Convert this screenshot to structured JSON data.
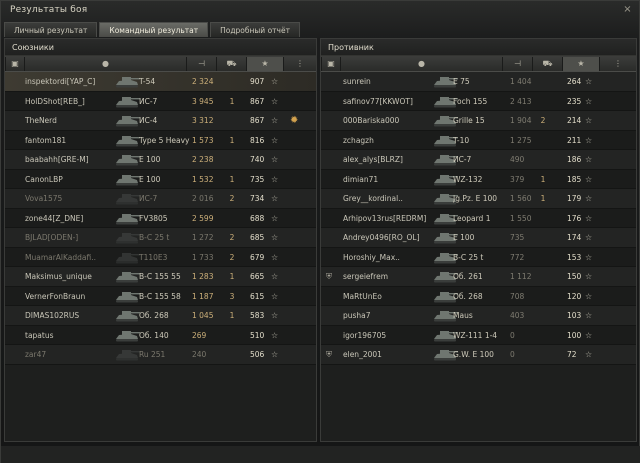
{
  "window": {
    "title": "Результаты боя",
    "close_icon": "×"
  },
  "tabs": [
    {
      "label": "Личный результат",
      "active": false
    },
    {
      "label": "Командный результат",
      "active": true
    },
    {
      "label": "Подробный отчёт",
      "active": false
    }
  ],
  "header_icons": [
    "platoon-icon",
    "player-icon",
    "damage-icon",
    "kills-icon",
    "xp-icon",
    "medals-icon"
  ],
  "allies": {
    "title": "Союзники",
    "rows": [
      {
        "player": "inspektordi[YAP_C]",
        "tank": "T-54",
        "damage": "2 324",
        "kills": "",
        "xp": "907",
        "me": true
      },
      {
        "player": "HolDShot[REB_]",
        "tank": "ИС-7",
        "damage": "3 945",
        "kills": "1",
        "xp": "867"
      },
      {
        "player": "TheNerd",
        "tank": "ИС-4",
        "damage": "3 312",
        "kills": "",
        "xp": "867",
        "medal": true
      },
      {
        "player": "fantom181",
        "tank": "Type 5 Heavy",
        "damage": "1 573",
        "kills": "1",
        "xp": "816"
      },
      {
        "player": "baabahh[GRE-M]",
        "tank": "E 100",
        "damage": "2 238",
        "kills": "",
        "xp": "740"
      },
      {
        "player": "CanonLBP",
        "tank": "E 100",
        "damage": "1 532",
        "kills": "1",
        "xp": "735"
      },
      {
        "player": "Vova1575",
        "tank": "ИС-7",
        "damage": "2 016",
        "kills": "2",
        "xp": "734",
        "dead": true
      },
      {
        "player": "zone44[Z_DNE]",
        "tank": "FV3805",
        "damage": "2 599",
        "kills": "",
        "xp": "688"
      },
      {
        "player": "BJLAD[ODEN-]",
        "tank": "B-C 25 t",
        "damage": "1 272",
        "kills": "2",
        "xp": "685",
        "dead": true
      },
      {
        "player": "MuamarAlKaddafi..",
        "tank": "T110E3",
        "damage": "1 733",
        "kills": "2",
        "xp": "679",
        "dead": true
      },
      {
        "player": "Maksimus_unique",
        "tank": "B-C 155 55",
        "damage": "1 283",
        "kills": "1",
        "xp": "665"
      },
      {
        "player": "VernerFonBraun",
        "tank": "B-C 155 58",
        "damage": "1 187",
        "kills": "3",
        "xp": "615"
      },
      {
        "player": "DIMAS102RUS",
        "tank": "Об. 268",
        "damage": "1 045",
        "kills": "1",
        "xp": "583"
      },
      {
        "player": "tapatus",
        "tank": "Об. 140",
        "damage": "269",
        "kills": "",
        "xp": "510"
      },
      {
        "player": "zar47",
        "tank": "Ru 251",
        "damage": "240",
        "kills": "",
        "xp": "506",
        "dead": true
      }
    ]
  },
  "enemies": {
    "title": "Противник",
    "rows": [
      {
        "player": "sunrein",
        "tank": "E 75",
        "damage": "1 404",
        "kills": "",
        "xp": "264"
      },
      {
        "player": "safinov77[KKWOT]",
        "tank": "Foch 155",
        "damage": "2 413",
        "kills": "",
        "xp": "235"
      },
      {
        "player": "000Bariska000",
        "tank": "Grille 15",
        "damage": "1 904",
        "kills": "2",
        "xp": "214"
      },
      {
        "player": "zchagzh",
        "tank": "T-10",
        "damage": "1 275",
        "kills": "",
        "xp": "211"
      },
      {
        "player": "alex_alys[BLRZ]",
        "tank": "ИС-7",
        "damage": "490",
        "kills": "",
        "xp": "186"
      },
      {
        "player": "dimian71",
        "tank": "WZ-132",
        "damage": "379",
        "kills": "1",
        "xp": "185"
      },
      {
        "player": "Grey__kordinal..",
        "tank": "Jg.Pz. E 100",
        "damage": "1 560",
        "kills": "1",
        "xp": "179"
      },
      {
        "player": "Arhipov13rus[REDRM]",
        "tank": "Leopard 1",
        "damage": "1 550",
        "kills": "",
        "xp": "176"
      },
      {
        "player": "Andrey0496[RO_OL]",
        "tank": "E 100",
        "damage": "735",
        "kills": "",
        "xp": "174"
      },
      {
        "player": "Horoshiy_Max..",
        "tank": "B-C 25 t",
        "damage": "772",
        "kills": "",
        "xp": "153"
      },
      {
        "player": "sergeiefrem",
        "tank": "Об. 261",
        "damage": "1 112",
        "kills": "",
        "xp": "150",
        "shield": true
      },
      {
        "player": "MaRtUnEo",
        "tank": "Об. 268",
        "damage": "708",
        "kills": "",
        "xp": "120"
      },
      {
        "player": "pusha7",
        "tank": "Maus",
        "damage": "403",
        "kills": "",
        "xp": "103"
      },
      {
        "player": "igor196705",
        "tank": "WZ-111 1-4",
        "damage": "0",
        "kills": "",
        "xp": "100"
      },
      {
        "player": "elen_2001",
        "tank": "G.W. E 100",
        "damage": "0",
        "kills": "",
        "xp": "72",
        "shield": true
      }
    ]
  },
  "colors": {
    "accent_xp": "#e2ddca",
    "damage": "#cdb07a",
    "dead_text": "#7b786d"
  }
}
